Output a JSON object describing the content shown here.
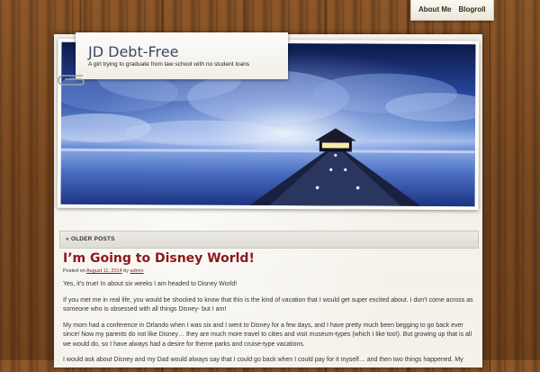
{
  "nav": {
    "items": [
      {
        "label": "About Me"
      },
      {
        "label": "Blogroll"
      }
    ]
  },
  "site": {
    "title": "JD Debt-Free",
    "tagline": "A girl trying to graduate from law school with no student loans"
  },
  "older_posts": {
    "label": "« OLDER POSTS"
  },
  "post": {
    "title": "I’m Going to Disney World!",
    "meta_prefix": "Posted on",
    "date": "August 11, 2014",
    "meta_by": "by",
    "author": "admin",
    "paragraphs": [
      "Yes, it’s true! In about six weeks I am headed to Disney World!",
      "If you met me in real life, you would be shocked to know that this is the kind of vacation that I would get super excited about. I don’t come across as someone who is obsessed with all things Disney- but I am!",
      "My mom had a conference in Orlando when I was six and I went to Disney for a few days, and I have pretty much been begging to go back ever since!  Now my parents do not like Disney… they are much more travel to cities and visit museum-types (which I like too!).  But growing up that is all we would do, so I have always had a desire for theme parks and cruise-type vacations.",
      "I would ask about Disney and my Dad would always say that I could go back when I could pay for it myself… and then two things happened.  My"
    ]
  }
}
